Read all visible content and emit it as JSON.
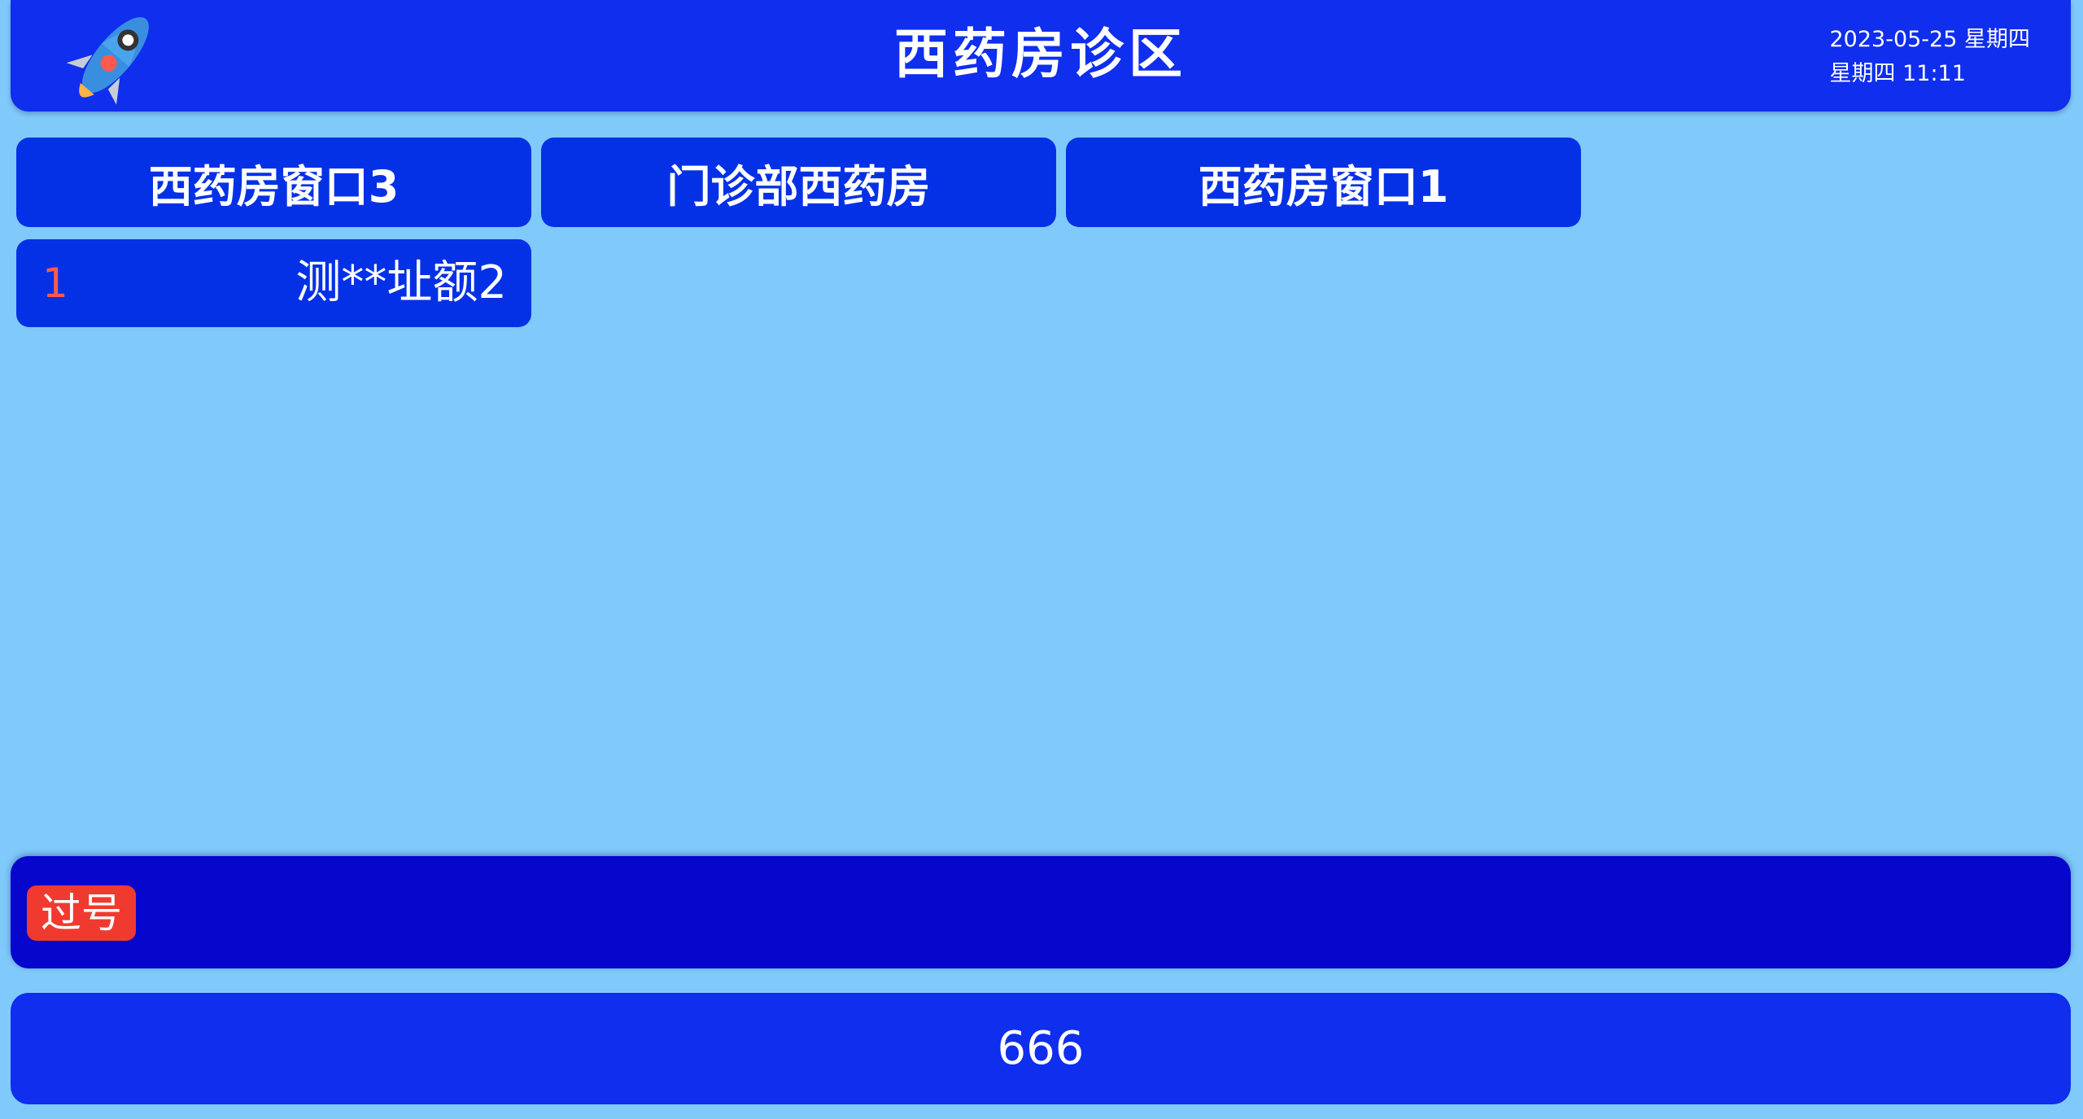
{
  "header": {
    "title": "西药房诊区",
    "date_line": "2023-05-25 星期四",
    "time_line": "星期四 11:11",
    "logo_icon": "rocket-icon"
  },
  "windows": [
    {
      "label": "西药房窗口3"
    },
    {
      "label": "门诊部西药房"
    },
    {
      "label": "西药房窗口1"
    }
  ],
  "queue": [
    {
      "number": "1",
      "name": "测**址额2"
    }
  ],
  "missed": {
    "label": "过号"
  },
  "footer": {
    "text": "666"
  },
  "colors": {
    "background": "#7fcafb",
    "header": "#0f2eee",
    "tab": "#0531e6",
    "missed_bar": "#0606cd",
    "badge": "#f13a2f",
    "queue_number": "#ff5a4d"
  }
}
